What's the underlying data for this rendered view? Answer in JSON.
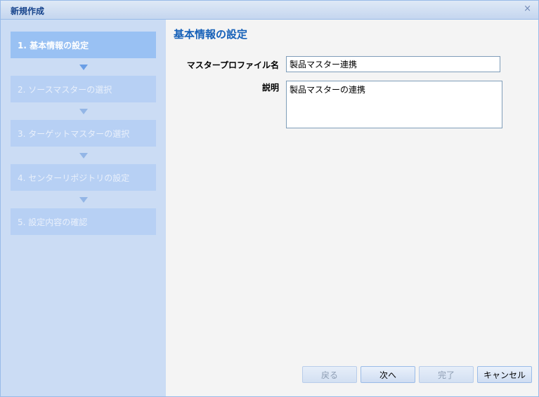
{
  "window": {
    "title": "新規作成",
    "close_glyph": "×"
  },
  "sidebar": {
    "steps": [
      {
        "label": "1. 基本情報の設定",
        "state": "active"
      },
      {
        "label": "2. ソースマスターの選択",
        "state": "inactive"
      },
      {
        "label": "3. ターゲットマスターの選択",
        "state": "inactive"
      },
      {
        "label": "4. センターリポジトリの設定",
        "state": "inactive"
      },
      {
        "label": "5. 設定内容の確認",
        "state": "inactive"
      }
    ]
  },
  "main": {
    "heading": "基本情報の設定",
    "profile_name": {
      "label": "マスタープロファイル名",
      "value": "製品マスター連携"
    },
    "description": {
      "label": "説明",
      "value": "製品マスターの連携"
    }
  },
  "buttons": {
    "back": {
      "label": "戻る",
      "enabled": false
    },
    "next": {
      "label": "次へ",
      "enabled": true
    },
    "finish": {
      "label": "完了",
      "enabled": false
    },
    "cancel": {
      "label": "キャンセル",
      "enabled": true
    }
  },
  "colors": {
    "accent": "#1560b8",
    "active_step": "#99c1f3",
    "inactive_step": "#b7d0f4"
  }
}
